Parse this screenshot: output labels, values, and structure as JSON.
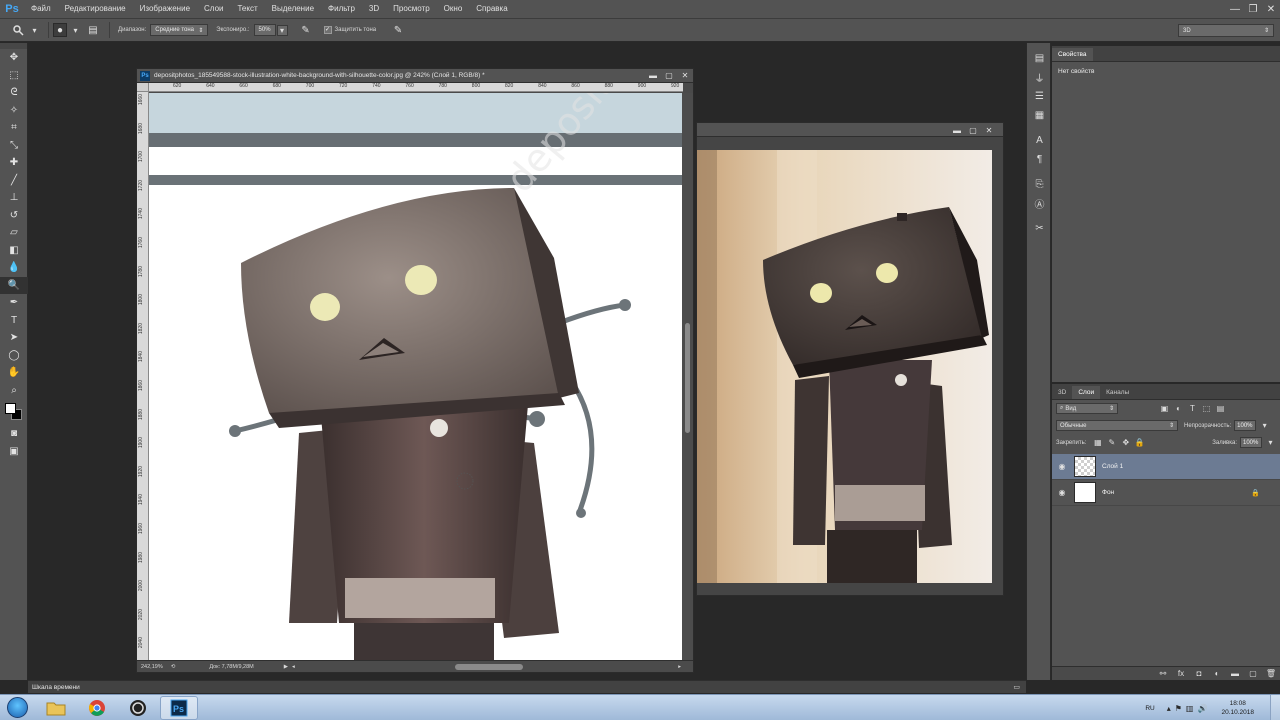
{
  "app": {
    "logo": "Ps",
    "menu": [
      "Файл",
      "Редактирование",
      "Изображение",
      "Слои",
      "Текст",
      "Выделение",
      "Фильтр",
      "3D",
      "Просмотр",
      "Окно",
      "Справка"
    ]
  },
  "options": {
    "range_label": "Диапазон:",
    "range_value": "Средние тона",
    "exposure_label": "Экспониро.:",
    "exposure_value": "50%",
    "protect_tones_label": "Защитить тона",
    "workspace_value": "3D"
  },
  "doc1": {
    "title": "depositphotos_185549588-stock-illustration-white-background-with-silhouette-color.jpg @ 242% (Слой 1, RGB/8) *",
    "ruler_marks": [
      "620",
      "640",
      "660",
      "680",
      "700",
      "720",
      "740",
      "760",
      "780",
      "800",
      "820",
      "840",
      "860",
      "880",
      "900",
      "920"
    ],
    "ruler_v_marks": [
      "1660",
      "1680",
      "1700",
      "1720",
      "1740",
      "1760",
      "1780",
      "1800",
      "1820",
      "1840",
      "1860",
      "1880",
      "1900",
      "1920",
      "1940",
      "1960",
      "1980",
      "2000",
      "2020",
      "2040"
    ],
    "zoom": "242,19%",
    "doc_size": "Док: 7,78M/9,28M",
    "watermark": "depositphotos"
  },
  "panels": {
    "properties_tab": "Свойства",
    "no_properties": "Нет свойств",
    "layers_tabs": [
      "3D",
      "Слои",
      "Каналы"
    ],
    "filter_kind": "Вид",
    "blend_mode": "Обычные",
    "opacity_label": "Непрозрачность:",
    "opacity_value": "100%",
    "lock_label": "Закрепить:",
    "fill_label": "Заливка:",
    "fill_value": "100%",
    "layers": [
      {
        "name": "Слой 1"
      },
      {
        "name": "Фон"
      }
    ]
  },
  "timeline": {
    "label": "Шкала времени"
  },
  "taskbar": {
    "lang": "RU",
    "time": "18:08",
    "date": "20.10.2018"
  },
  "colors": {
    "ui_panel": "#535353",
    "ui_dark": "#282828",
    "selected_layer": "#6c7b93",
    "ps_blue": "#46a8f5"
  }
}
